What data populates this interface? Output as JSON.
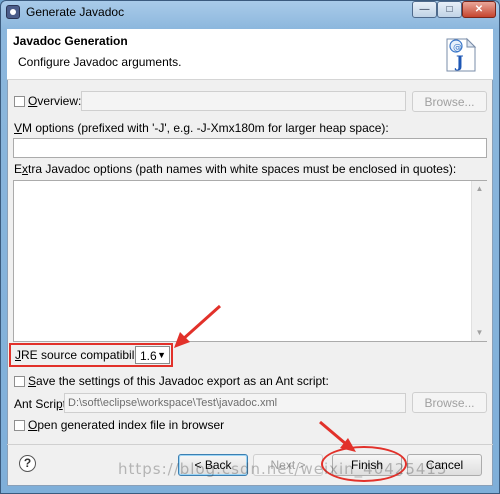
{
  "window": {
    "title": "Generate Javadoc",
    "min_glyph": "—",
    "max_glyph": "□",
    "close_glyph": "✕"
  },
  "banner": {
    "title": "Javadoc Generation",
    "subtitle": "Configure Javadoc arguments.",
    "icon": "javadoc-file-icon"
  },
  "overview": {
    "label_mnemonic": "O",
    "label_rest": "verview:",
    "checked": false,
    "value": "",
    "browse_label": "Browse..."
  },
  "vm_options": {
    "label_mnemonic": "V",
    "label_rest": "M options (prefixed with '-J', e.g. -J-Xmx180m for larger heap space):",
    "value": ""
  },
  "extra_options": {
    "label_pre": "E",
    "label_mnemonic": "x",
    "label_rest": "tra Javadoc options (path names with white spaces must be enclosed in quotes):",
    "value": ""
  },
  "jre": {
    "label_mnemonic": "J",
    "label_rest": "RE source compatibility:",
    "value": "1.6",
    "caret": "▼"
  },
  "ant_save": {
    "label_mnemonic": "S",
    "label_rest": "ave the settings of this Javadoc export as an Ant script:",
    "checked": false
  },
  "ant_script": {
    "label_pre": "Ant Scri",
    "label_mnemonic": "p",
    "label_rest": "t:",
    "value": "D:\\soft\\eclipse\\workspace\\Test\\javadoc.xml",
    "browse_label": "Browse..."
  },
  "open_index": {
    "label_mnemonic": "O",
    "label_rest": "pen generated index file in browser",
    "checked": false
  },
  "footer": {
    "help_glyph": "?",
    "back_label": "< Back",
    "next_label": "Next >",
    "finish_label": "Finish",
    "cancel_label": "Cancel"
  },
  "watermark": "https://blog.csdn.net/weixin_40425415",
  "colors": {
    "annotation": "#e2312a",
    "titlebar": "#8cb7dd",
    "dialog_bg": "#f0f0f0"
  }
}
